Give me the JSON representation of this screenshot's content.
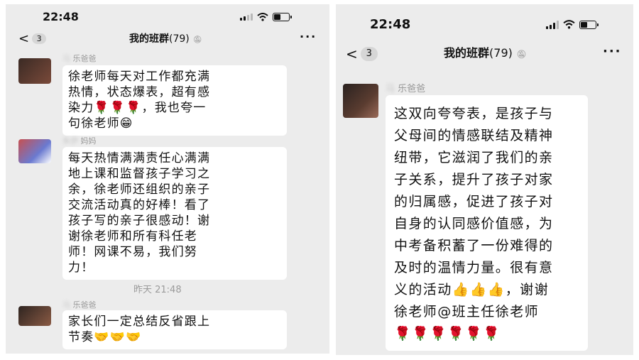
{
  "left": {
    "status_time": "22:48",
    "back_count": "3",
    "title": "我的班群",
    "member_count": "(79)",
    "messages": [
      {
        "sender_visible": "乐爸爸",
        "text": "徐老师每天对工作都充满\n热情，状态爆表，超有感\n染力🌹🌹🌹，我也夸一\n句徐老师😁"
      },
      {
        "sender_visible": "妈妈",
        "text": "每天热情满满责任心满满\n地上课和监督孩子学习之\n余，徐老师还组织的亲子\n交流活动真的好棒！看了\n孩子写的亲子很感动！谢\n谢徐老师和所有科任老\n师！网课不易，我们努\n力！"
      },
      {
        "sender_visible": "乐爸爸",
        "text": "家长们一定总结反省跟上\n节奏🤝🤝🤝"
      }
    ],
    "timestamp": "昨天 21:48"
  },
  "right": {
    "status_time": "22:48",
    "back_count": "3",
    "title": "我的班群",
    "member_count": "(79)",
    "sender_visible": "乐爸爸",
    "text": "这双向夸夸表，是孩子与\n父母间的情感联结及精神\n纽带，它滋润了我们的亲\n子关系，提升了孩子对家\n的归属感，促进了孩子对\n自身的认同感价值感，为\n中考备积蓄了一份难得的\n及时的温情力量。很有意\n义的活动👍👍👍，谢谢\n徐老师@班主任徐老师\n🌹🌹🌹🌹🌹🌹"
  }
}
